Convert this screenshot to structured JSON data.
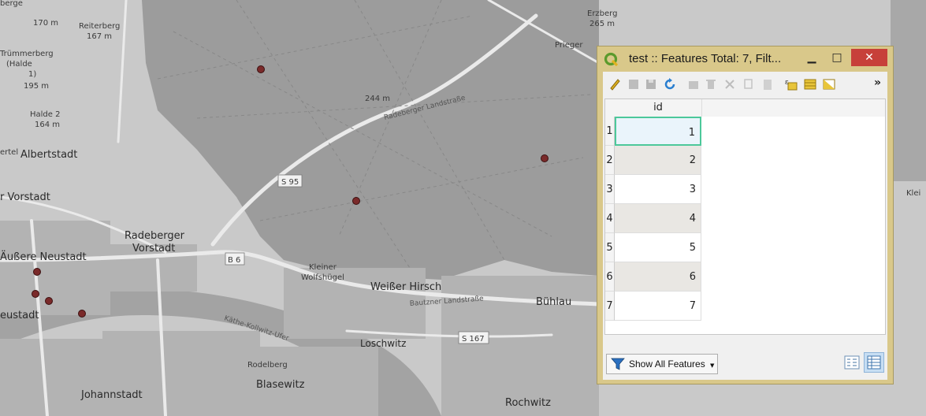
{
  "map": {
    "labels": {
      "elevation_170": "170 m",
      "reiterberg": "Reiterberg",
      "reiterberg_elev": "167 m",
      "trummerberg": "Trümmerberg",
      "halde": "(Halde",
      "halde_1": "1)",
      "elev_195": "195 m",
      "halde2": "Halde 2",
      "elev_164": "164 m",
      "albertstadt": "Albertstadt",
      "r_vorstadt": "r Vorstadt",
      "radeberger": "Radeberger",
      "vorstadt": "Vorstadt",
      "aussere_neustadt": "Äußere Neustadt",
      "neustadt": "eustadt",
      "erzberg": "Erzberg",
      "erzberg_elev": "265 m",
      "elev_244": "244 m",
      "radeberger_landstrasse": "Radeberger Landstraße",
      "s95": "S 95",
      "b6": "B 6",
      "kleiner": "Kleiner",
      "wolfshuegel": "Wolfshügel",
      "weisser_hirsch": "Weißer Hirsch",
      "bautzner": "Bautzner Landstraße",
      "buehlau": "Bühlau",
      "katheekollwitz": "Käthe-Kollwitz-Ufer",
      "loschwitz": "Loschwitz",
      "s167": "S 167",
      "rodelberg": "Rodelberg",
      "blasewitz": "Blasewitz",
      "johannstadt": "Johannstadt",
      "rochwitz": "Rochwitz",
      "kleir": "Klei",
      "berge": "berge",
      "ertel": "ertel",
      "prieger": "Prieger"
    }
  },
  "window": {
    "title": "test :: Features Total: 7, Filt...",
    "minimize": "▁",
    "maximize": "□",
    "close": "✕"
  },
  "table": {
    "column_header": "id",
    "rows": [
      {
        "num": "1",
        "id": "1"
      },
      {
        "num": "2",
        "id": "2"
      },
      {
        "num": "3",
        "id": "3"
      },
      {
        "num": "4",
        "id": "4"
      },
      {
        "num": "5",
        "id": "5"
      },
      {
        "num": "6",
        "id": "6"
      },
      {
        "num": "7",
        "id": "7"
      }
    ]
  },
  "footer": {
    "show_all_label": "Show All Features"
  },
  "toolbar": {
    "more": "»"
  },
  "colors": {
    "window_frame": "#d9c88a",
    "close_button": "#c7403a",
    "selection_border": "#4cc89a",
    "feature_point": "#7a2a2a"
  }
}
